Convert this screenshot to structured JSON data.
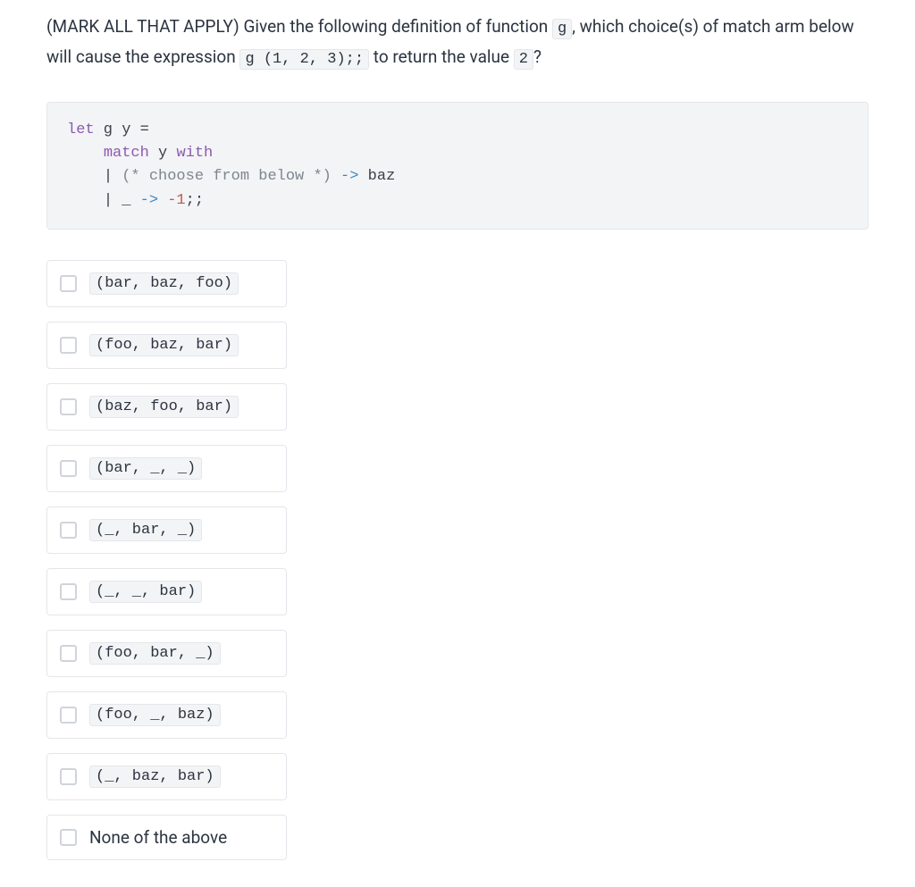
{
  "question": {
    "prefix": "(MARK ALL THAT APPLY) Given the following definition of function ",
    "code1": "g",
    "mid1": ", which choice(s) of match arm below will cause the expression ",
    "code2": "g (1, 2, 3);;",
    "mid2": " to return the value ",
    "code3": "2",
    "suffix": "?"
  },
  "codeblock": {
    "let": "let",
    "fn_decl": " g y =",
    "indent1": "    ",
    "match": "match",
    "match_y": " y ",
    "with": "with",
    "indent2": "    ",
    "pipe1": "| ",
    "comment": "(* choose from below *)",
    "arrow1": " -> ",
    "baz": "baz",
    "pipe2": "| ",
    "under": "_",
    "arrow2": " -> ",
    "neg1": "-1",
    "semi": ";;"
  },
  "options": [
    {
      "label": "(bar, baz, foo)",
      "is_code": true
    },
    {
      "label": "(foo, baz, bar)",
      "is_code": true
    },
    {
      "label": "(baz, foo, bar)",
      "is_code": true
    },
    {
      "label": "(bar, _, _)",
      "is_code": true
    },
    {
      "label": "(_, bar, _)",
      "is_code": true
    },
    {
      "label": "(_, _, bar)",
      "is_code": true
    },
    {
      "label": "(foo, bar, _)",
      "is_code": true
    },
    {
      "label": "(foo, _, baz)",
      "is_code": true
    },
    {
      "label": "(_, baz, bar)",
      "is_code": true
    },
    {
      "label": "None of the above",
      "is_code": false
    }
  ]
}
